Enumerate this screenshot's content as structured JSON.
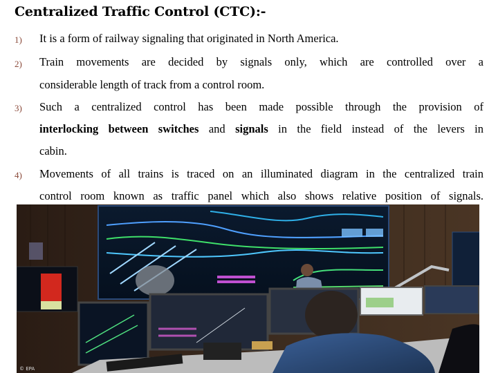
{
  "slide": {
    "title": "Centralized Traffic Control (CTC):-",
    "points": [
      {
        "number": "1)",
        "lines": [
          "It  is a form of railway signaling  that originated in North America."
        ]
      },
      {
        "number": "2)",
        "lines": [
          "Train movements are decided by signals only, which are controlled over a",
          "considerable length of track from a control room."
        ]
      },
      {
        "number": "3)",
        "line1": "Such a centralized control has been  made possible through the provision of",
        "line2_parts": {
          "bold1": "interlocking between switches",
          "mid1": " and ",
          "bold2": "signals",
          "rest": " in the field instead of the levers in"
        },
        "line3": "cabin."
      },
      {
        "number": "4)",
        "lines": [
          "Movements of all trains is traced on an illuminated diagram in the centralized train",
          "control room known as traffic panel which also shows relative position of signals."
        ]
      }
    ],
    "image": {
      "description": "Railway traffic control room with large illuminated track diagram wall and operator workstations",
      "credit": "© EPA"
    }
  }
}
